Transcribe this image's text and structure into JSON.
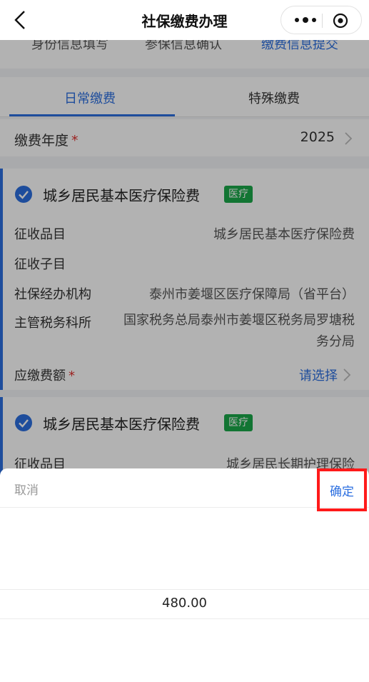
{
  "navbar": {
    "title": "社保缴费办理"
  },
  "steps": [
    "身份信息填写",
    "参保信息确认",
    "缴费信息提交"
  ],
  "tabs": [
    "日常缴费",
    "特殊缴费"
  ],
  "year": {
    "label": "缴费年度",
    "required_mark": "*",
    "value": "2025"
  },
  "card1": {
    "title": "城乡居民基本医疗保险费",
    "badge": "医疗",
    "rows": [
      {
        "label": "征收品目",
        "value": "城乡居民基本医疗保险费"
      },
      {
        "label": "征收子目",
        "value": ""
      },
      {
        "label": "社保经办机构",
        "value": "泰州市姜堰区医疗保障局（省平台）"
      },
      {
        "label": "主管税务科所",
        "value": "国家税务总局泰州市姜堰区税务局罗塘税务分局"
      },
      {
        "label": "应缴费额",
        "required_mark": "*",
        "value": "请选择"
      }
    ]
  },
  "card2": {
    "title": "城乡居民基本医疗保险费",
    "badge": "医疗",
    "rows": [
      {
        "label": "征收品目",
        "value": "城乡居民长期护理保险"
      }
    ]
  },
  "picker": {
    "cancel_label": "取消",
    "confirm_label": "确定",
    "options": [
      "480.00"
    ]
  },
  "colors": {
    "accent": "#2c6fe0",
    "badge": "#1aa84a",
    "highlight": "#ff1a1a",
    "required": "#e0312f"
  }
}
